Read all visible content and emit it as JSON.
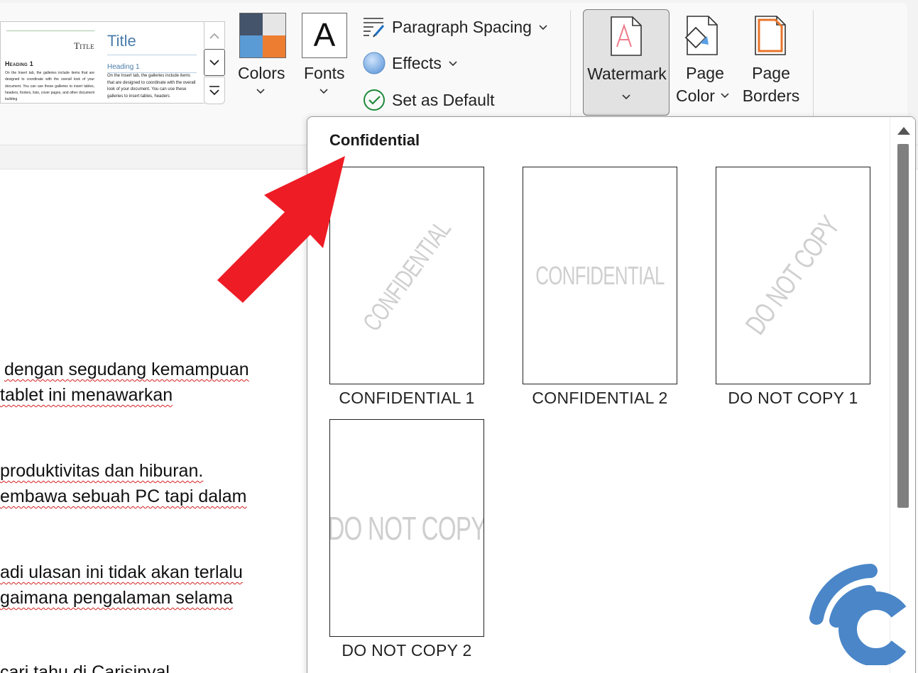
{
  "style_gallery": {
    "preview1": {
      "title": "Title",
      "heading": "Heading 1",
      "body": "On the Insert tab, the galleries include items that are designed to coordinate with the overall look of your document. You can use these galleries to insert tables, headers, footers, lists, cover pages, and other document building"
    },
    "preview2": {
      "title": "Title",
      "heading": "Heading 1",
      "body": "On the Insert tab, the galleries include items that are designed to coordinate with the overall look of your document. You can use these galleries to insert tables, headers"
    }
  },
  "ribbon": {
    "colors_label": "Colors",
    "fonts_label": "Fonts",
    "fonts_glyph": "A",
    "paragraph_spacing_label": "Paragraph Spacing",
    "effects_label": "Effects",
    "set_default_label": "Set as Default",
    "watermark_label": "Watermark",
    "page_color_line1": "Page",
    "page_color_line2": "Color",
    "page_borders_line1": "Page",
    "page_borders_line2": "Borders",
    "chevron": "⌄",
    "colors_swatches": [
      "#44546a",
      "#e7e6e6",
      "#5b9bd5",
      "#ed7d31"
    ]
  },
  "document": {
    "lines": [
      "dengan segudang kemampuan",
      "tablet ini menawarkan",
      "produktivitas dan hiburan.",
      "embawa sebuah PC tapi dalam",
      "adi ulasan ini tidak akan terlalu",
      "gaimana pengalaman selama",
      "cari tahu di Carisinyal"
    ]
  },
  "watermark_gallery": {
    "section_title": "Confidential",
    "items": [
      {
        "caption": "CONFIDENTIAL 1",
        "mark": "CONFIDENTIAL",
        "orientation": "diagonal"
      },
      {
        "caption": "CONFIDENTIAL 2",
        "mark": "CONFIDENTIAL",
        "orientation": "horizontal"
      },
      {
        "caption": "DO NOT COPY 1",
        "mark": "DO NOT COPY",
        "orientation": "diagonal"
      },
      {
        "caption": "DO NOT COPY 2",
        "mark": "DO NOT COPY",
        "orientation": "horizontal"
      }
    ]
  },
  "colors": {
    "annotation_arrow": "#ee1c25",
    "logo_blue": "#4a86c8",
    "watermark_text": "#cfcfcf"
  }
}
